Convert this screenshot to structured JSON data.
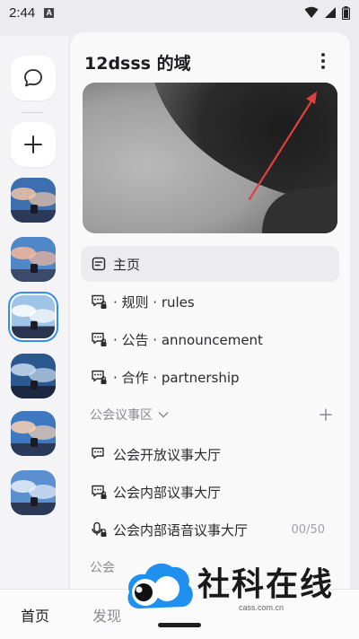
{
  "status": {
    "time": "2:44",
    "notif_badge": "A"
  },
  "rail": {
    "chat_icon": "chat-bubble-icon",
    "add_icon": "plus-icon",
    "servers": [
      "server-1",
      "server-2",
      "server-3",
      "server-4",
      "server-5",
      "server-6"
    ],
    "selected_index": 2
  },
  "server": {
    "name": "12dsss 的域",
    "menu_icon": "kebab-menu-icon"
  },
  "channels": {
    "home": {
      "label": "主页",
      "icon": "home-channel-icon"
    },
    "text_channels": [
      {
        "label": "· 规则 · rules",
        "icon": "locked-chat-icon"
      },
      {
        "label": "· 公告 · announcement",
        "icon": "locked-chat-icon"
      },
      {
        "label": "· 合作 · partnership",
        "icon": "locked-chat-icon"
      }
    ],
    "category": {
      "label": "公会议事区",
      "icon": "chevron-down-icon",
      "add_icon": "plus-icon"
    },
    "category_channels": [
      {
        "label": "公会开放议事大厅",
        "icon": "chat-icon"
      },
      {
        "label": "公会内部议事大厅",
        "icon": "locked-chat-icon"
      },
      {
        "label": "公会内部语音议事大厅",
        "icon": "locked-voice-icon",
        "count": "00/50"
      }
    ],
    "partial_category": "公会"
  },
  "tabs": [
    {
      "label": "首页",
      "active": true
    },
    {
      "label": "发现",
      "active": false
    }
  ],
  "watermark": {
    "brand": "社科在线",
    "url": "cass.com.cn"
  },
  "colors": {
    "accent": "#2f8df0",
    "arrow": "#e0403a",
    "panel": "#f9f9fa"
  }
}
